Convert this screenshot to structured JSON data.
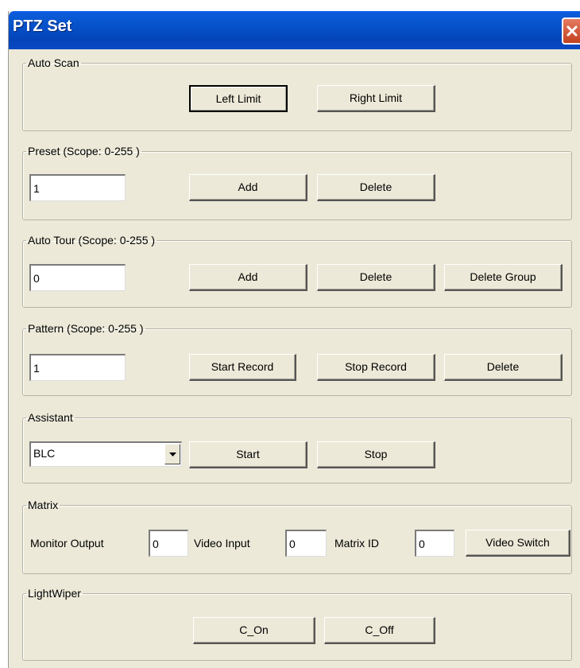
{
  "window": {
    "title": "PTZ Set"
  },
  "auto_scan": {
    "legend": "Auto Scan",
    "left_limit": "Left Limit",
    "right_limit": "Right Limit"
  },
  "preset": {
    "legend": "Preset (Scope: 0-255 )",
    "value": "1",
    "add": "Add",
    "delete": "Delete"
  },
  "auto_tour": {
    "legend": "Auto Tour (Scope: 0-255 )",
    "value": "0",
    "add": "Add",
    "delete": "Delete",
    "delete_group": "Delete Group"
  },
  "pattern": {
    "legend": "Pattern (Scope: 0-255 )",
    "value": "1",
    "start_record": "Start Record",
    "stop_record": "Stop Record",
    "delete": "Delete"
  },
  "assistant": {
    "legend": "Assistant",
    "selected": "BLC",
    "start": "Start",
    "stop": "Stop"
  },
  "matrix": {
    "legend": "Matrix",
    "monitor_output_label": "Monitor Output",
    "monitor_output_value": "0",
    "video_input_label": "Video Input",
    "video_input_value": "0",
    "matrix_id_label": "Matrix ID",
    "matrix_id_value": "0",
    "video_switch": "Video Switch"
  },
  "lightwiper": {
    "legend": "LightWiper",
    "c_on": "C_On",
    "c_off": "C_Off"
  },
  "icons": {
    "close": "close-icon",
    "dropdown": "chevron-down-icon"
  }
}
